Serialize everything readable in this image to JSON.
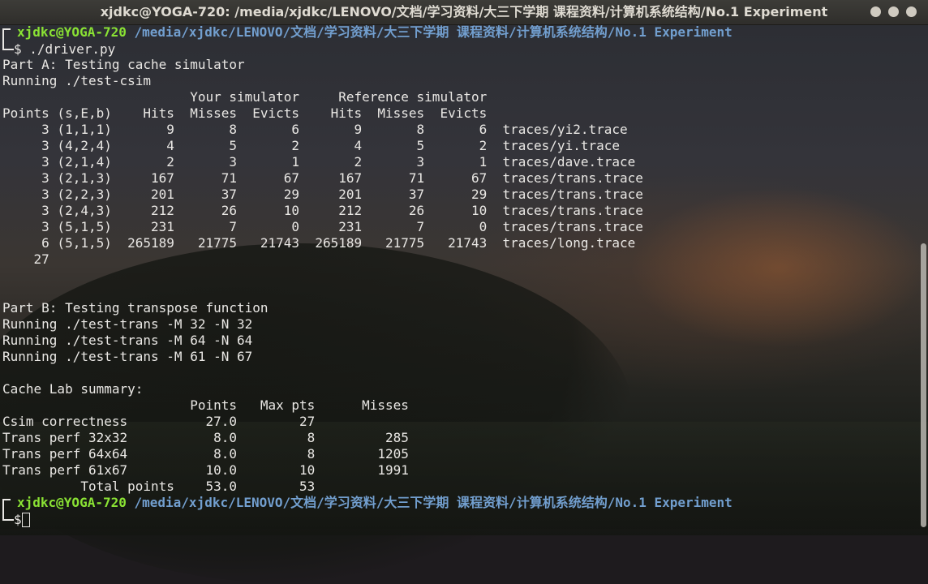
{
  "window": {
    "title": "xjdkc@YOGA-720: /media/xjdkc/LENOVO/文档/学习资料/大三下学期 课程资料/计算机系统结构/No.1 Experiment"
  },
  "prompt": {
    "user_host": "xjdkc@YOGA-720",
    "path": "/media/xjdkc/LENOVO/文档/学习资料/大三下学期 课程资料/计算机系统结构/No.1 Experiment",
    "symbol": "$"
  },
  "command": "./driver.py",
  "output_lines": [
    "Part A: Testing cache simulator",
    "Running ./test-csim",
    "                        Your simulator     Reference simulator",
    "Points (s,E,b)    Hits  Misses  Evicts    Hits  Misses  Evicts",
    "     3 (1,1,1)       9       8       6       9       8       6  traces/yi2.trace",
    "     3 (4,2,4)       4       5       2       4       5       2  traces/yi.trace",
    "     3 (2,1,4)       2       3       1       2       3       1  traces/dave.trace",
    "     3 (2,1,3)     167      71      67     167      71      67  traces/trans.trace",
    "     3 (2,2,3)     201      37      29     201      37      29  traces/trans.trace",
    "     3 (2,4,3)     212      26      10     212      26      10  traces/trans.trace",
    "     3 (5,1,5)     231       7       0     231       7       0  traces/trans.trace",
    "     6 (5,1,5)  265189   21775   21743  265189   21775   21743  traces/long.trace",
    "    27",
    "",
    "",
    "Part B: Testing transpose function",
    "Running ./test-trans -M 32 -N 32",
    "Running ./test-trans -M 64 -N 64",
    "Running ./test-trans -M 61 -N 67",
    "",
    "Cache Lab summary:",
    "                        Points   Max pts      Misses",
    "Csim correctness          27.0        27",
    "Trans perf 32x32           8.0         8         285",
    "Trans perf 64x64           8.0         8        1205",
    "Trans perf 61x67          10.0        10        1991",
    "          Total points    53.0        53"
  ]
}
